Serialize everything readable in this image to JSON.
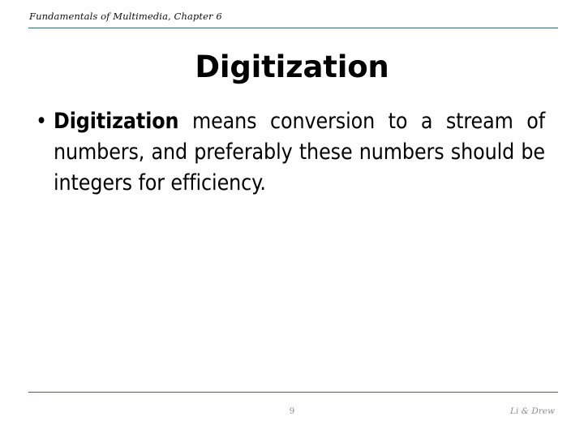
{
  "slide": {
    "header": {
      "text": "Fundamentals of Multimedia, Chapter 6"
    },
    "title": "Digitization",
    "body": {
      "bullets": [
        {
          "marker": "•",
          "lead_term": "Digitization",
          "rest": " means conversion to a stream of numbers, and preferably these numbers should be integers for efficiency."
        }
      ]
    },
    "footer": {
      "page_number": "9",
      "credit": "Li & Drew"
    },
    "colors": {
      "rule": "#3d6370",
      "text": "#000000",
      "footer_text": "#8c8c8c",
      "background": "#ffffff"
    }
  }
}
